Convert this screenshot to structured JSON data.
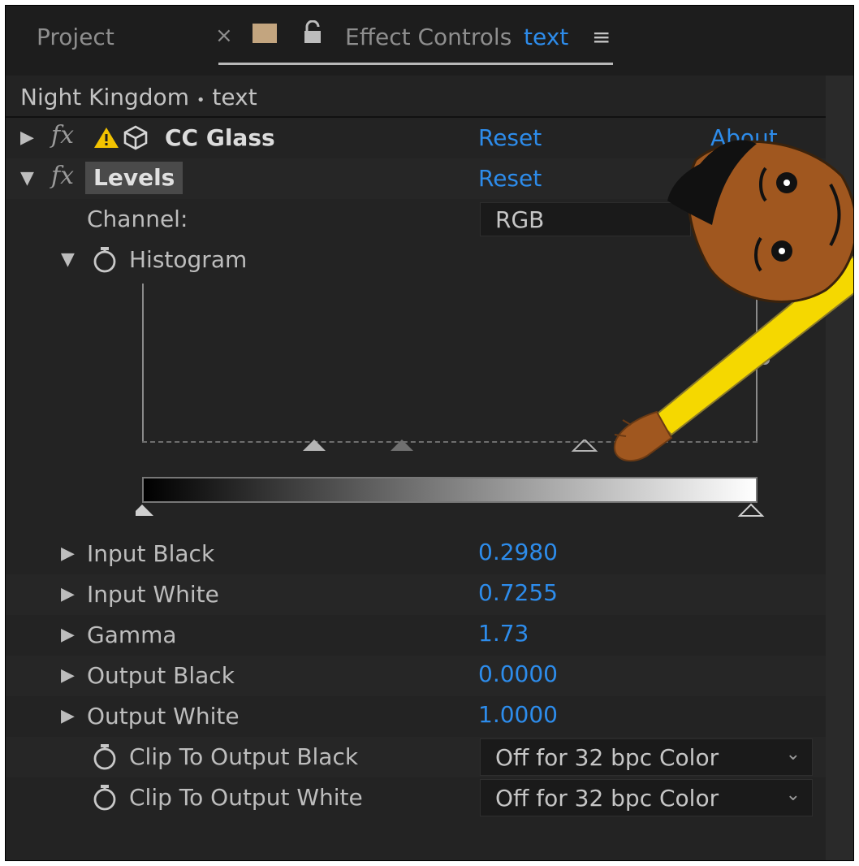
{
  "tabs": {
    "project": "Project",
    "close": "×",
    "effect_controls": "Effect Controls",
    "layer": "text",
    "menu": "≡"
  },
  "breadcrumb": {
    "comp": "Night Kingdom",
    "separator": "•",
    "layer": "text"
  },
  "effects": [
    {
      "name": "CC Glass",
      "reset": "Reset",
      "about": "About"
    },
    {
      "name": "Levels",
      "reset": "Reset"
    }
  ],
  "levels": {
    "channel_label": "Channel:",
    "channel_value": "RGB",
    "histogram_label": "Histogram",
    "params": [
      {
        "label": "Input Black",
        "value": "0.2980"
      },
      {
        "label": "Input White",
        "value": "0.7255"
      },
      {
        "label": "Gamma",
        "value": "1.73"
      },
      {
        "label": "Output Black",
        "value": "0.0000"
      },
      {
        "label": "Output White",
        "value": "1.0000"
      }
    ],
    "clip_black_label": "Clip To Output Black",
    "clip_black_value": "Off for 32 bpc Color",
    "clip_white_label": "Clip To Output White",
    "clip_white_value": "Off for 32 bpc Color"
  },
  "colors": {
    "accent": "#2d8ceb",
    "panel": "#232323",
    "label_swatch": "#c3a57f",
    "character_shirt": "#f5d800",
    "character_skin": "#a0571f"
  },
  "icons": [
    "lock-icon",
    "warning-icon",
    "3d-cube-icon",
    "stopwatch-icon",
    "chevron-down-icon",
    "disclosure-triangle-icon"
  ]
}
